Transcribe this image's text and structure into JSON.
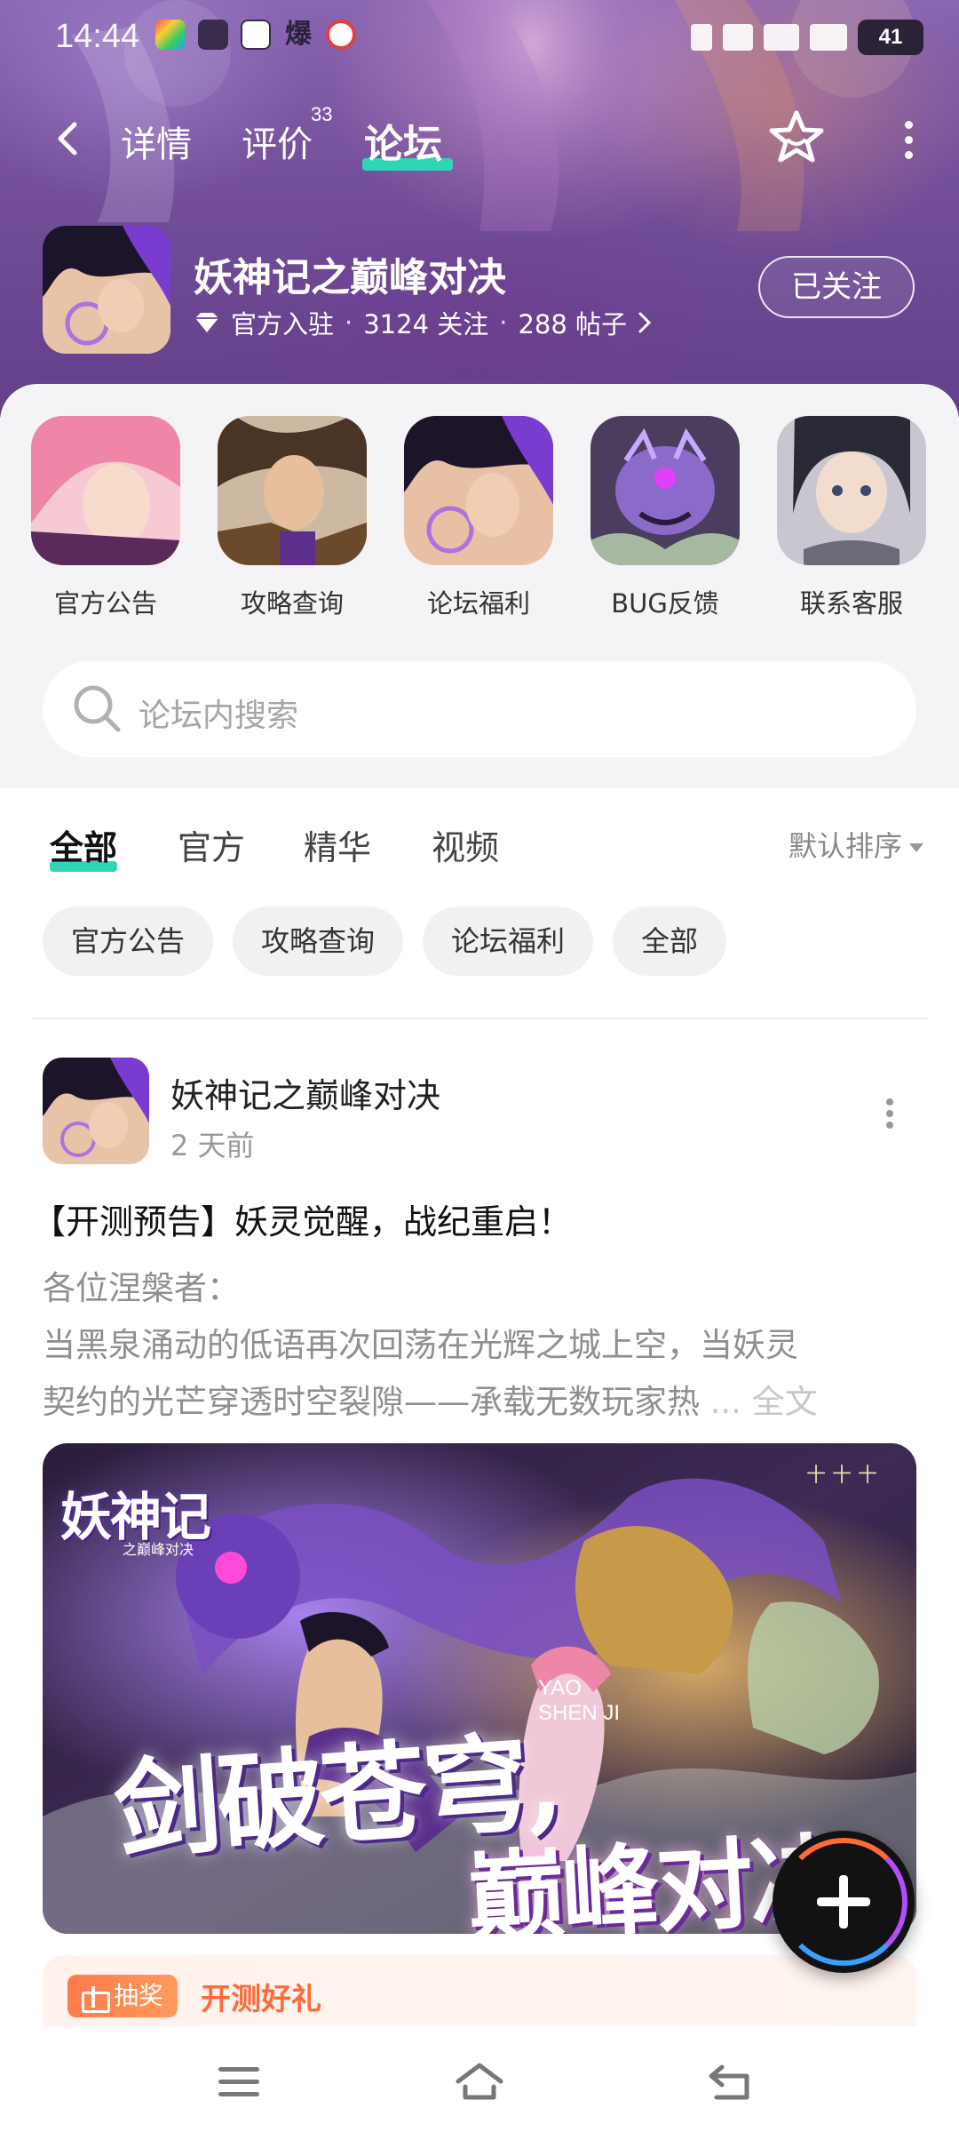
{
  "status_bar": {
    "time": "14:44",
    "battery": "41"
  },
  "nav": {
    "tabs": [
      {
        "label": "详情"
      },
      {
        "label": "评价",
        "badge": "33"
      },
      {
        "label": "论坛"
      }
    ],
    "active_tab": "论坛"
  },
  "game": {
    "title": "妖神记之巅峰对决",
    "official": "官方入驻",
    "followers": "3124 关注",
    "posts": "288 帖子",
    "follow_button": "已关注"
  },
  "shortcuts": [
    {
      "label": "官方公告"
    },
    {
      "label": "攻略查询"
    },
    {
      "label": "论坛福利"
    },
    {
      "label": "BUG反馈"
    },
    {
      "label": "联系客服"
    }
  ],
  "search": {
    "placeholder": "论坛内搜索"
  },
  "feed_tabs": [
    "全部",
    "官方",
    "精华",
    "视频"
  ],
  "active_feed_tab": "全部",
  "sort": {
    "label": "默认排序"
  },
  "chips": [
    "官方公告",
    "攻略查询",
    "论坛福利",
    "全部"
  ],
  "post": {
    "author": "妖神记之巅峰对决",
    "time": "2 天前",
    "title": "【开测预告】妖灵觉醒，战纪重启！",
    "body_lines": [
      "各位涅槃者：",
      "当黑泉涌动的低语再次回荡在光辉之城上空，当妖灵",
      "契约的光芒穿透时空裂隙——承载无数玩家热"
    ],
    "more": "... 全文",
    "image": {
      "logo": "妖神记",
      "logo_sub": "之巅峰对决",
      "slogan_1": "剑破苍穹,",
      "slogan_2": "巅峰对决",
      "yao_1": "YAO",
      "yao_2": "SHEN JI",
      "corner_text": "十 十 十"
    }
  },
  "promo": {
    "tag": "抽奖",
    "title": "开测好礼"
  },
  "colors": {
    "accent": "#2fd6b5",
    "header_purple": "#7b559f",
    "promo_orange": "#ff6a3a"
  }
}
